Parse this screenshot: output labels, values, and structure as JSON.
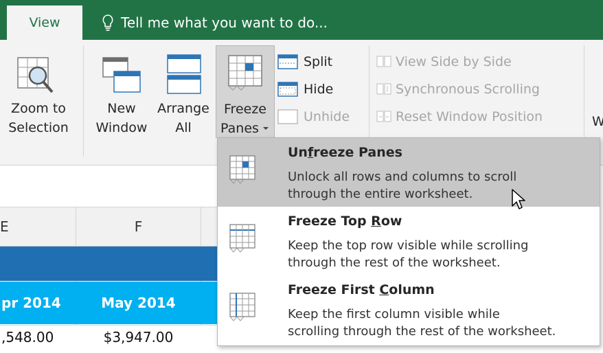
{
  "tabs": {
    "view_label": "View"
  },
  "tellme": {
    "text": "Tell me what you want to do..."
  },
  "ribbon": {
    "zoom_selection": {
      "line1": "Zoom to",
      "line2": "Selection"
    },
    "new_window": {
      "line1": "New",
      "line2": "Window"
    },
    "arrange_all": {
      "line1": "Arrange",
      "line2": "All"
    },
    "freeze_panes": {
      "line1": "Freeze",
      "line2": "Panes"
    },
    "split_label": "Split",
    "hide_label": "Hide",
    "unhide_label": "Unhide",
    "view_side_by_side": "View Side by Side",
    "synchronous_scrolling": "Synchronous Scrolling",
    "reset_window_position": "Reset Window Position",
    "cut_off_label": "W"
  },
  "sheet": {
    "col_e": "E",
    "col_f": "F",
    "month_e": "pr 2014",
    "month_f": "May 2014",
    "value_e": ",548.00",
    "value_f": "$3,947.00"
  },
  "menu": {
    "items": [
      {
        "title_pre": "Un",
        "title_key": "f",
        "title_post": "reeze Panes",
        "desc1": "Unlock all rows and columns to scroll",
        "desc2": "through the entire worksheet."
      },
      {
        "title_pre": "Freeze Top ",
        "title_key": "R",
        "title_post": "ow",
        "desc1": "Keep the top row visible while scrolling",
        "desc2": "through the rest of the worksheet."
      },
      {
        "title_pre": "Freeze First ",
        "title_key": "C",
        "title_post": "olumn",
        "desc1": "Keep the first column visible while",
        "desc2": "scrolling through the rest of the worksheet."
      }
    ]
  },
  "colors": {
    "excel_green": "#217346",
    "header_blue": "#1f6fb2",
    "month_cyan": "#00b0f0",
    "highlight": "#c7c7c7"
  }
}
